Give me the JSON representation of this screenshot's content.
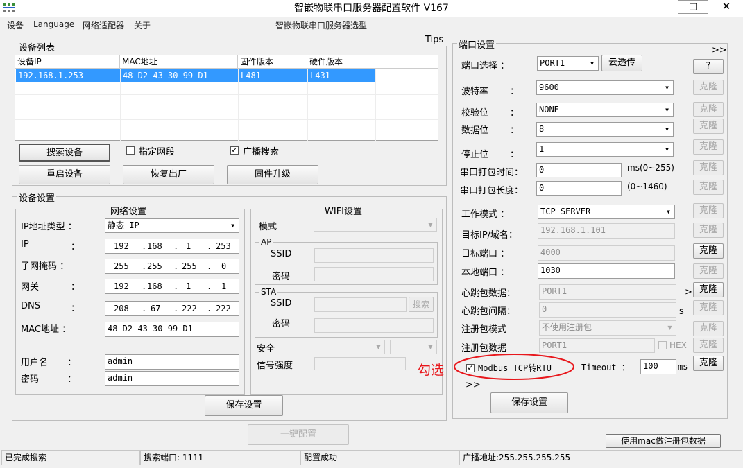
{
  "window": {
    "title": "智嵌物联串口服务器配置软件   V167",
    "minimize": "—",
    "maximize": "□",
    "close": "✕",
    "icon": "app-icon"
  },
  "menu": {
    "items": [
      "设备",
      "Language",
      "网络适配器",
      "关于"
    ],
    "model_select": "智嵌物联串口服务器选型"
  },
  "tips": "Tips",
  "device_list": {
    "title": "设备列表",
    "columns": [
      "设备IP",
      "MAC地址",
      "固件版本",
      "硬件版本"
    ],
    "rows": [
      [
        "192.168.1.253",
        "48-D2-43-30-99-D1",
        "L481",
        "L431"
      ]
    ],
    "search_button": "搜索设备",
    "reboot_button": "重启设备",
    "restore_button": "恢复出厂",
    "upgrade_button": "固件升级",
    "specify_segment": "指定网段",
    "specify_segment_checked": false,
    "broadcast_search": "广播搜索",
    "broadcast_search_checked": true
  },
  "device_settings": {
    "title": "设备设置",
    "network": {
      "title": "网络设置",
      "ip_type_label": "IP地址类型 ：",
      "ip_type_value": "静态 IP",
      "ip_label": "IP",
      "ip": [
        "192",
        "168",
        "1",
        "253"
      ],
      "mask_label": "子网掩码 ：",
      "mask": [
        "255",
        "255",
        "255",
        "0"
      ],
      "gateway_label": "网关",
      "gateway": [
        "192",
        "168",
        "1",
        "1"
      ],
      "dns_label": "DNS",
      "dns": [
        "208",
        "67",
        "222",
        "222"
      ],
      "mac_label": "MAC地址 ：",
      "mac": "48-D2-43-30-99-D1",
      "username_label": "用户名",
      "username": "admin",
      "password_label": "密码",
      "password": "admin",
      "colon": "："
    },
    "wifi": {
      "title": "WIFI设置",
      "mode_label": "模式",
      "ap_title": "AP",
      "ssid_label": "SSID",
      "password_label": "密码",
      "sta_title": "STA",
      "search_button": "搜索",
      "security_label": "安全",
      "signal_label": "信号强度"
    },
    "save_button": "保存设置"
  },
  "one_key": "一键配置",
  "port_settings": {
    "title": "端口设置",
    "expand": ">>",
    "collapse": ">>",
    "help_button": "?",
    "clone": "克隆",
    "port_select_label": "端口选择 ：",
    "port_select_value": "PORT1",
    "cloud_button": "云透传",
    "baud_label": "波特率",
    "baud_value": "9600",
    "parity_label": "校验位",
    "parity_value": "NONE",
    "databits_label": "数据位",
    "databits_value": "8",
    "stopbits_label": "停止位",
    "stopbits_value": "1",
    "colon": "：",
    "pack_time_label": "串口打包时间：",
    "pack_time_value": "0",
    "pack_time_unit": "ms(0~255)",
    "pack_len_label": "串口打包长度：",
    "pack_len_value": "0",
    "pack_len_unit": "(0~1460)",
    "work_mode_label": "工作模式 ：",
    "work_mode_value": "TCP_SERVER",
    "target_ip_label": "目标IP/域名：",
    "target_ip_value": "192.168.1.101",
    "target_port_label": "目标端口 ：",
    "target_port_value": "4000",
    "local_port_label": "本地端口 ：",
    "local_port_value": "1030",
    "heartbeat_data_label": "心跳包数据：",
    "heartbeat_data_value": "PORT1",
    "heartbeat_more": ">",
    "heartbeat_interval_label": "心跳包间隔：",
    "heartbeat_interval_value": "0",
    "heartbeat_interval_unit": "s",
    "register_mode_label": "注册包模式",
    "register_mode_value": "不使用注册包",
    "register_data_label": "注册包数据",
    "register_data_value": "PORT1",
    "hex_label": "HEX",
    "modbus_label": "Modbus TCP转RTU",
    "modbus_checked": true,
    "timeout_label": "Timeout ：",
    "timeout_value": "100",
    "timeout_unit": "ms",
    "save_button": "保存设置"
  },
  "annotation": {
    "text": "勾选",
    "color": "#e8171c"
  },
  "mac_register_button": "使用mac做注册包数据",
  "status_bar": [
    "已完成搜索",
    "搜索端口: 1111",
    "配置成功",
    "广播地址:255.255.255.255"
  ],
  "colors": {
    "selection": "#3399ff",
    "annotation": "#e8171c"
  }
}
